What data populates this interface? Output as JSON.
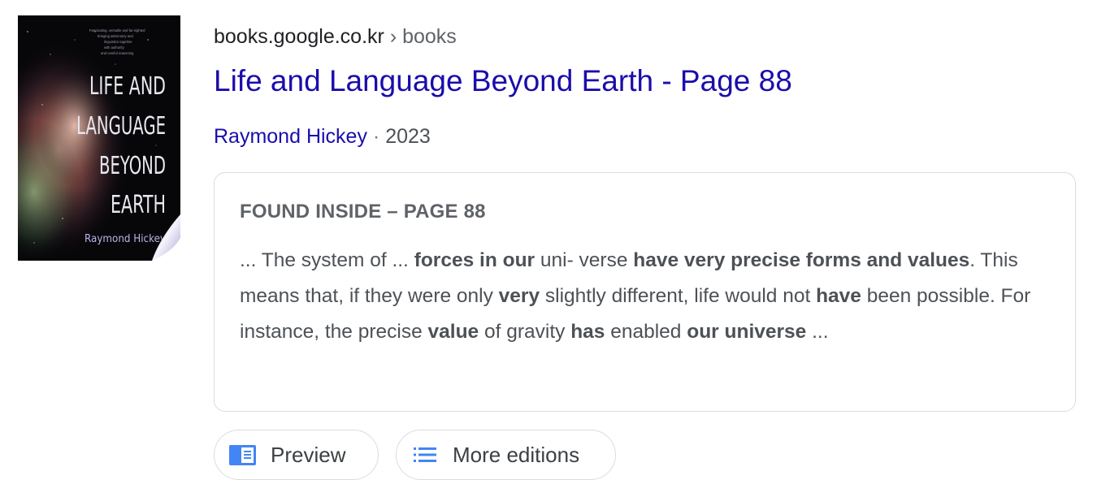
{
  "cover": {
    "title_lines": [
      "LIFE AND",
      "LANGUAGE",
      "BEYOND",
      "EARTH"
    ],
    "author": "Raymond Hickey",
    "blurb_lines": [
      "Fascinating, versatile and far-sighted",
      "bringing astronomy and",
      "linguistics together",
      "with authority",
      "and careful reasoning"
    ]
  },
  "result": {
    "site": "books.google.co.kr",
    "separator": "›",
    "path": "books",
    "title": "Life and Language Beyond Earth - Page 88",
    "author": "Raymond Hickey",
    "dot": "·",
    "year": "2023"
  },
  "snippet": {
    "label": "FOUND INSIDE – PAGE 88",
    "segments": [
      {
        "text": "... The system of ... ",
        "bold": false
      },
      {
        "text": "forces in our",
        "bold": true
      },
      {
        "text": " uni- verse ",
        "bold": false
      },
      {
        "text": "have very precise forms and values",
        "bold": true
      },
      {
        "text": ". This means that, if they were only ",
        "bold": false
      },
      {
        "text": "very",
        "bold": true
      },
      {
        "text": " slightly different, life would not ",
        "bold": false
      },
      {
        "text": "have",
        "bold": true
      },
      {
        "text": " been possible. For instance, the precise ",
        "bold": false
      },
      {
        "text": "value",
        "bold": true
      },
      {
        "text": " of gravity ",
        "bold": false
      },
      {
        "text": "has",
        "bold": true
      },
      {
        "text": " enabled ",
        "bold": false
      },
      {
        "text": "our universe",
        "bold": true
      },
      {
        "text": " ...",
        "bold": false
      }
    ]
  },
  "buttons": {
    "preview": {
      "label": "Preview",
      "icon": "book-preview-icon"
    },
    "editions": {
      "label": "More editions",
      "icon": "list-icon"
    }
  },
  "colors": {
    "link": "#1a0dab",
    "icon_blue": "#4285f4",
    "text_gray": "#4d5156",
    "border": "#dadce0"
  }
}
